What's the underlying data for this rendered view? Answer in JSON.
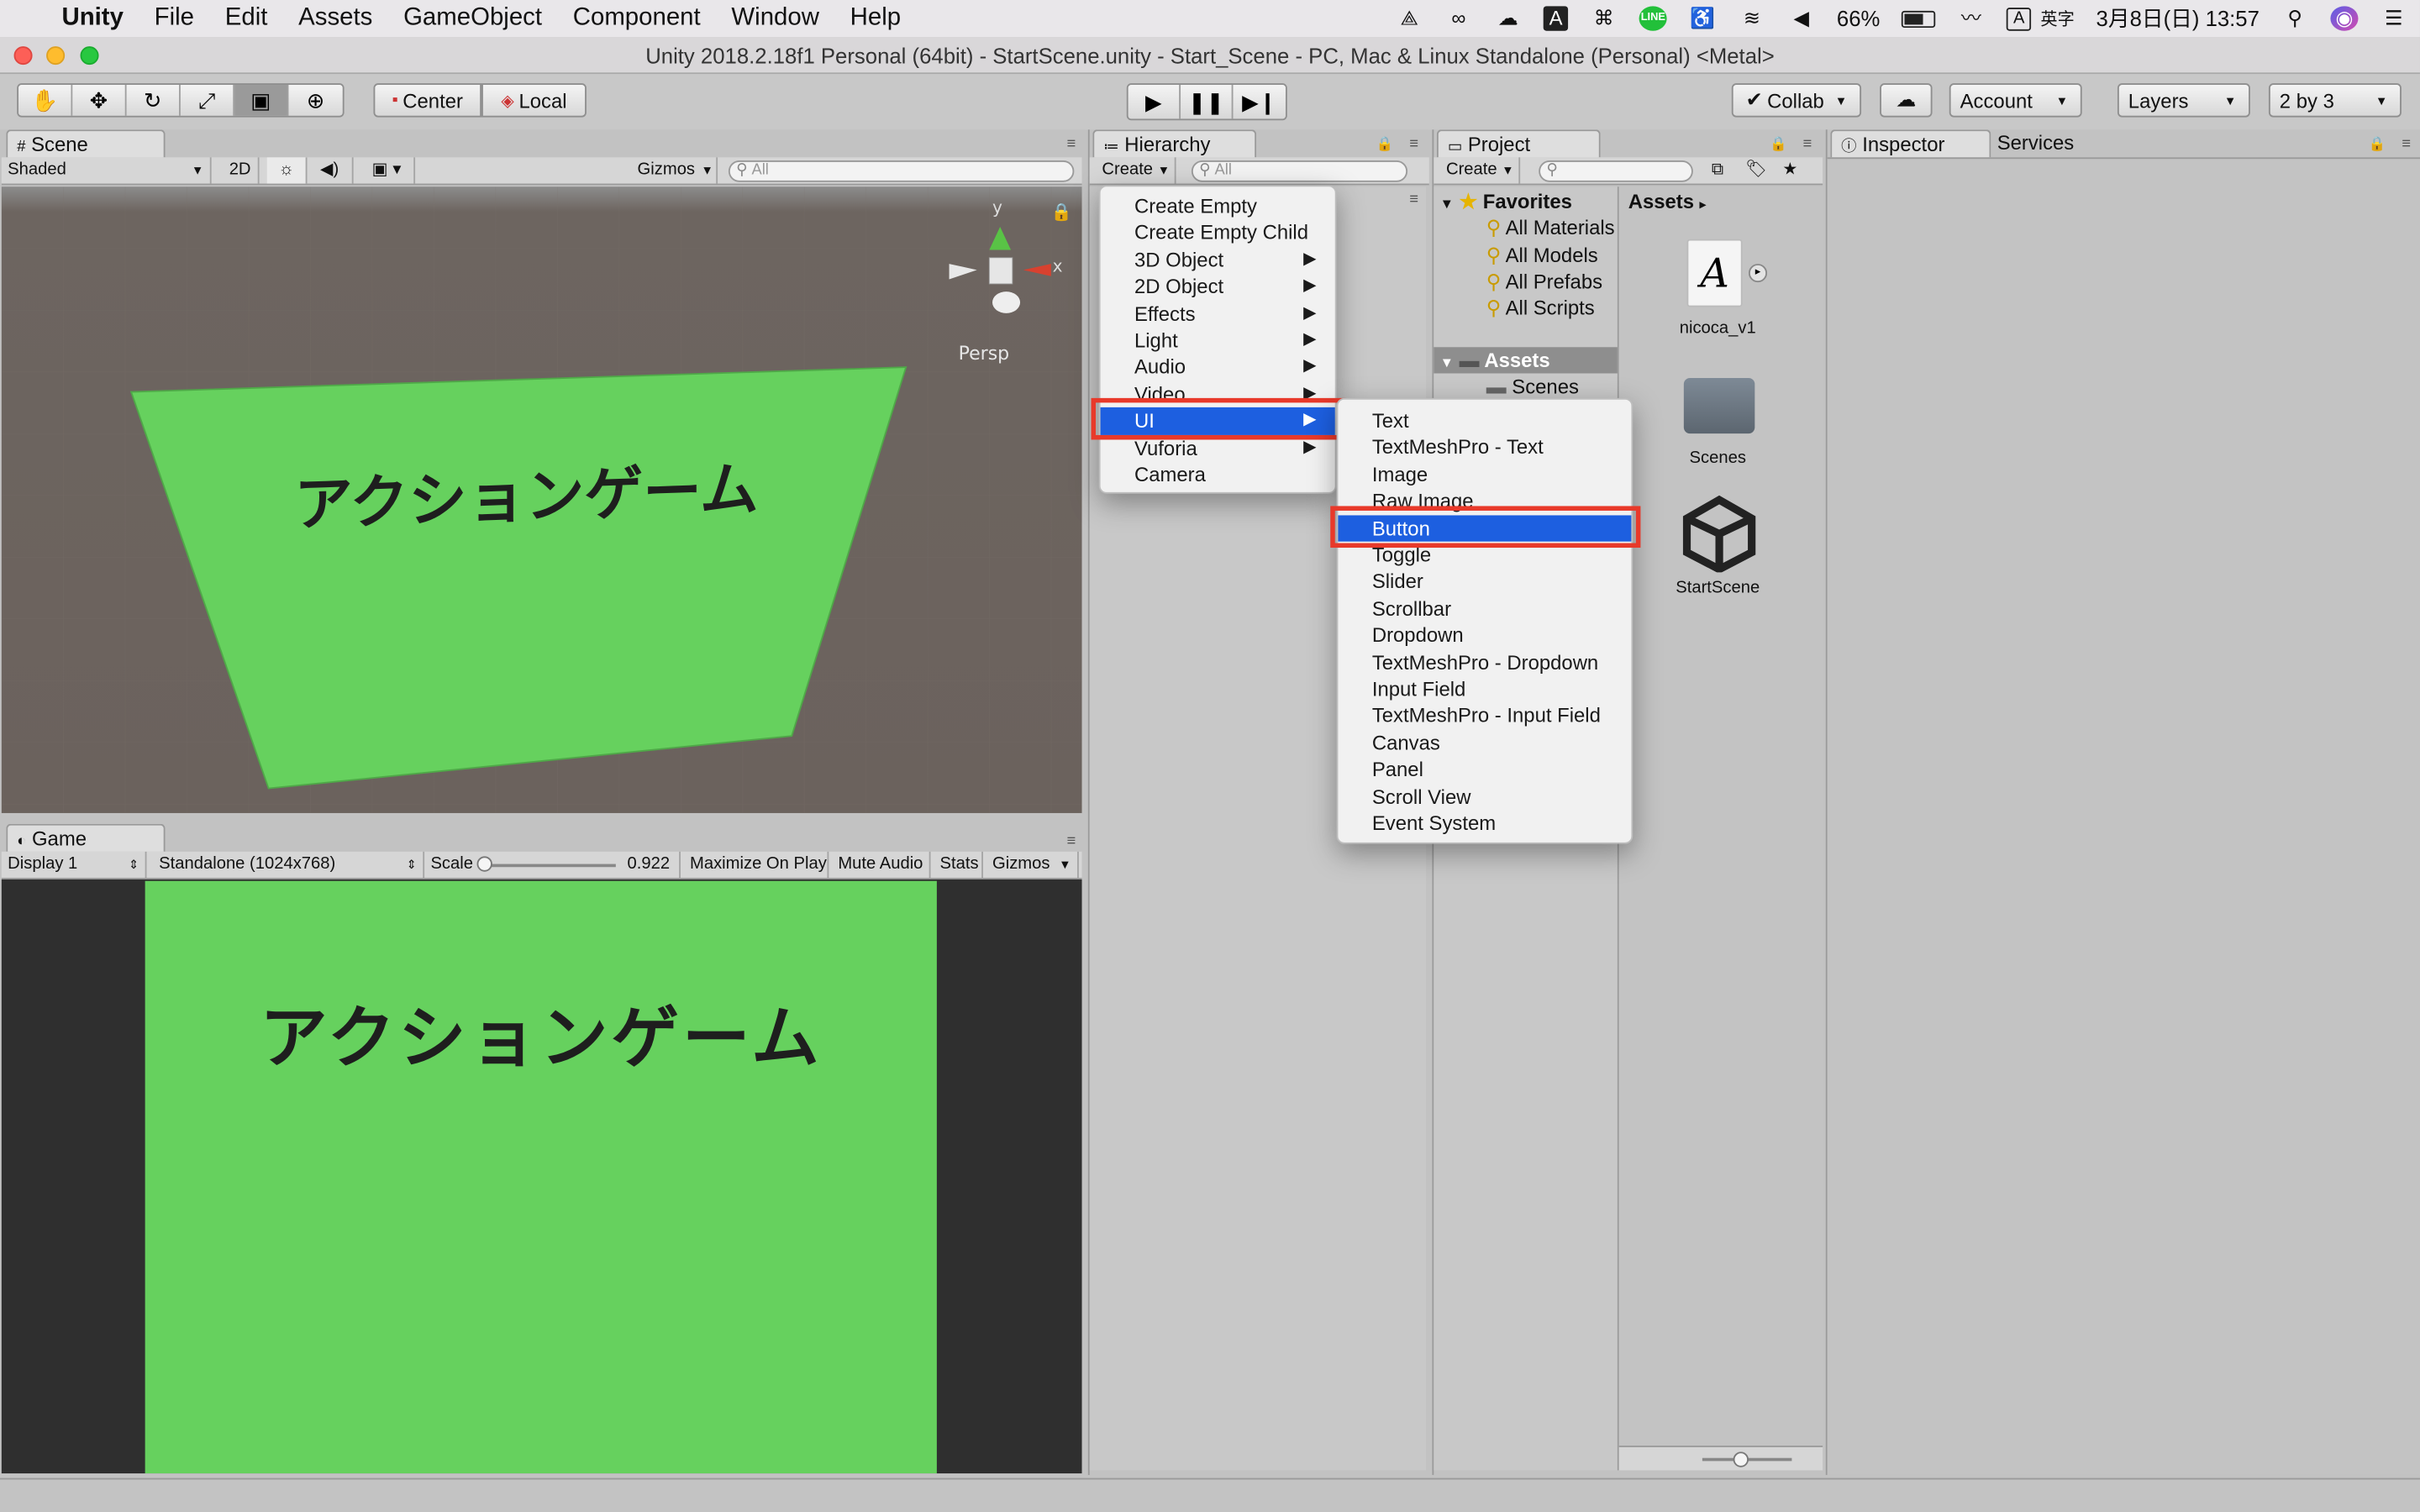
{
  "menubar": {
    "app_name": "Unity",
    "items": [
      "File",
      "Edit",
      "Assets",
      "GameObject",
      "Component",
      "Window",
      "Help"
    ],
    "status": {
      "ime_badge": "A",
      "ime_label": "英字",
      "battery": "66%",
      "datetime": "3月8日(日) 13:57",
      "line_badge": "LINE"
    }
  },
  "window": {
    "title": "Unity 2018.2.18f1 Personal (64bit) - StartScene.unity - Start_Scene - PC, Mac & Linux Standalone (Personal) <Metal>"
  },
  "toolbar": {
    "center": "Center",
    "local": "Local",
    "collab": "Collab",
    "account": "Account",
    "layers": "Layers",
    "layout": "2 by 3"
  },
  "scene": {
    "tab": "Scene",
    "shading": "Shaded",
    "mode_2d": "2D",
    "gizmos": "Gizmos",
    "search_placeholder": "All",
    "persp": "Persp",
    "axis_x": "x",
    "axis_y": "y",
    "title_text": "アクションゲーム",
    "bg_color": "#66d15e"
  },
  "game": {
    "tab": "Game",
    "display": "Display 1",
    "resolution": "Standalone (1024x768)",
    "scale_label": "Scale",
    "scale_value": "0.922",
    "maximize": "Maximize On Play",
    "mute": "Mute Audio",
    "stats": "Stats",
    "gizmos": "Gizmos",
    "title_text": "アクションゲーム"
  },
  "hierarchy": {
    "tab": "Hierarchy",
    "create": "Create",
    "search_placeholder": "All"
  },
  "create_menu": {
    "items": [
      {
        "label": "Create Empty",
        "submenu": false,
        "selected": false
      },
      {
        "label": "Create Empty Child",
        "submenu": false,
        "selected": false
      },
      {
        "label": "3D Object",
        "submenu": true,
        "selected": false
      },
      {
        "label": "2D Object",
        "submenu": true,
        "selected": false
      },
      {
        "label": "Effects",
        "submenu": true,
        "selected": false
      },
      {
        "label": "Light",
        "submenu": true,
        "selected": false
      },
      {
        "label": "Audio",
        "submenu": true,
        "selected": false
      },
      {
        "label": "Video",
        "submenu": true,
        "selected": false
      },
      {
        "label": "UI",
        "submenu": true,
        "selected": true
      },
      {
        "label": "Vuforia",
        "submenu": true,
        "selected": false
      },
      {
        "label": "Camera",
        "submenu": false,
        "selected": false
      }
    ]
  },
  "ui_submenu": {
    "items": [
      {
        "label": "Text",
        "selected": false
      },
      {
        "label": "TextMeshPro - Text",
        "selected": false
      },
      {
        "label": "Image",
        "selected": false
      },
      {
        "label": "Raw Image",
        "selected": false
      },
      {
        "label": "Button",
        "selected": true
      },
      {
        "label": "Toggle",
        "selected": false
      },
      {
        "label": "Slider",
        "selected": false
      },
      {
        "label": "Scrollbar",
        "selected": false
      },
      {
        "label": "Dropdown",
        "selected": false
      },
      {
        "label": "TextMeshPro - Dropdown",
        "selected": false
      },
      {
        "label": "Input Field",
        "selected": false
      },
      {
        "label": "TextMeshPro - Input Field",
        "selected": false
      },
      {
        "label": "Canvas",
        "selected": false
      },
      {
        "label": "Panel",
        "selected": false
      },
      {
        "label": "Scroll View",
        "selected": false
      },
      {
        "label": "Event System",
        "selected": false
      }
    ]
  },
  "project": {
    "tab": "Project",
    "create": "Create",
    "favorites_label": "Favorites",
    "favorites": [
      "All Materials",
      "All Models",
      "All Prefabs",
      "All Scripts"
    ],
    "assets_label": "Assets",
    "assets_children": [
      "Scenes"
    ],
    "breadcrumb": "Assets",
    "files": [
      {
        "name": "nicoca_v1",
        "icon": "font-icon"
      },
      {
        "name": "Scenes",
        "icon": "folder-icon"
      },
      {
        "name": "StartScene",
        "icon": "unity-scene-icon"
      }
    ]
  },
  "inspector": {
    "tab": "Inspector",
    "services_tab": "Services"
  }
}
